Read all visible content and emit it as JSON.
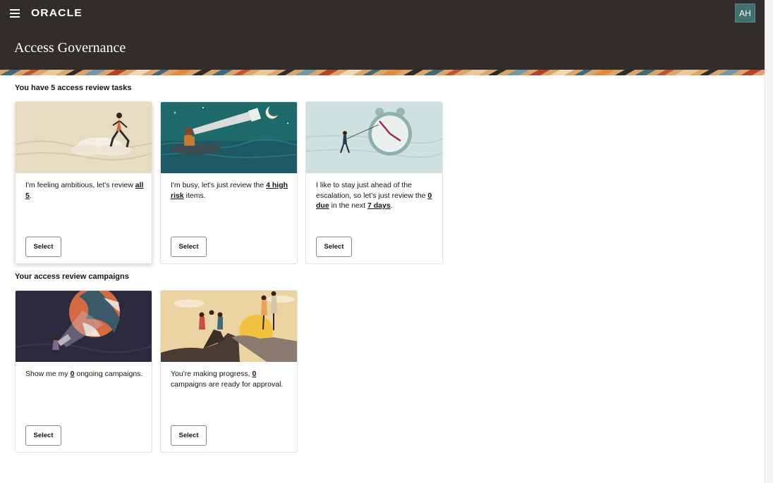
{
  "header": {
    "logo": "ORACLE",
    "logo_trademark": "®",
    "avatar_initials": "AH",
    "app_title": "Access Governance"
  },
  "tasks": {
    "heading": "You have 5 access review tasks",
    "cards": [
      {
        "text_before": "I'm feeling ambitious, let's review ",
        "link1": "all 5",
        "text_mid": ".",
        "link2": "",
        "text_after": "",
        "select_label": "Select",
        "illustration": "woman-climbing-cloud-illustration"
      },
      {
        "text_before": "I'm busy, let's just review the ",
        "link1": "4 high risk",
        "text_mid": " items.",
        "link2": "",
        "text_after": "",
        "select_label": "Select",
        "illustration": "telescope-boat-illustration"
      },
      {
        "text_before": "I like to stay just ahead of the escalation, so let's just review the ",
        "link1": "0 due",
        "text_mid": " in the next ",
        "link2": "7 days",
        "text_after": ".",
        "select_label": "Select",
        "illustration": "clock-pull-illustration"
      }
    ]
  },
  "campaigns": {
    "heading": "Your access review campaigns",
    "cards": [
      {
        "text_before": "Show me my ",
        "link1": "0",
        "text_mid": " ongoing campaigns.",
        "select_label": "Select",
        "illustration": "flashlight-planet-illustration"
      },
      {
        "text_before": "You're making progress, ",
        "link1": "0",
        "text_mid": " campaigns are ready for approval.",
        "select_label": "Select",
        "illustration": "cliff-helping-hand-illustration"
      }
    ]
  },
  "colors": {
    "header_bg": "#312d2a",
    "avatar_bg": "#3f6f6e"
  }
}
